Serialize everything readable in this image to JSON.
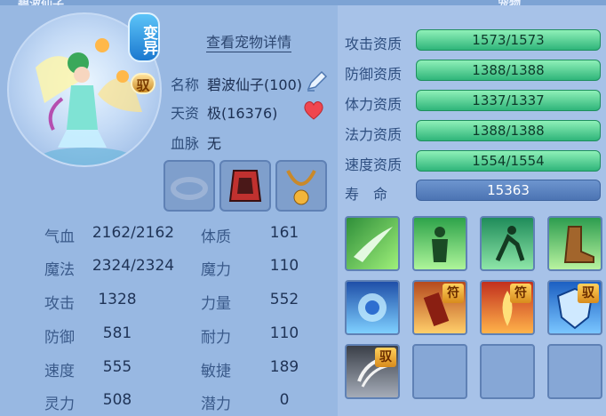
{
  "header": {
    "left_title": "碧波仙子",
    "right_title": "宠物"
  },
  "pet": {
    "variant_label": "变异",
    "rune_label": "驭",
    "view_detail_label": "查看宠物详情",
    "name_label": "名称",
    "name_value": "碧波仙子(100)",
    "talent_label": "天资",
    "talent_value": "极(16376)",
    "bloodline_label": "血脉",
    "bloodline_value": "无"
  },
  "stats": [
    {
      "label": "气血",
      "value": "2162/2162"
    },
    {
      "label": "魔法",
      "value": "2324/2324"
    },
    {
      "label": "攻击",
      "value": "1328"
    },
    {
      "label": "防御",
      "value": "581"
    },
    {
      "label": "速度",
      "value": "555"
    },
    {
      "label": "灵力",
      "value": "508"
    }
  ],
  "attributes": [
    {
      "label": "体质",
      "value": "161"
    },
    {
      "label": "魔力",
      "value": "110"
    },
    {
      "label": "力量",
      "value": "552"
    },
    {
      "label": "耐力",
      "value": "110"
    },
    {
      "label": "敏捷",
      "value": "189"
    },
    {
      "label": "潜力",
      "value": "0"
    }
  ],
  "aptitudes": [
    {
      "label": "攻击资质",
      "value": "1573/1573"
    },
    {
      "label": "防御资质",
      "value": "1388/1388"
    },
    {
      "label": "体力资质",
      "value": "1337/1337"
    },
    {
      "label": "法力资质",
      "value": "1388/1388"
    },
    {
      "label": "速度资质",
      "value": "1554/1554"
    }
  ],
  "lifespan": {
    "label": "寿　命",
    "value": "15363"
  },
  "skills": [
    {
      "icon": "wind-blade-skill-icon"
    },
    {
      "icon": "green-aura-skill-icon"
    },
    {
      "icon": "dash-skill-icon"
    },
    {
      "icon": "boot-skill-icon"
    },
    {
      "icon": "water-spirit-skill-icon"
    },
    {
      "icon": "talisman-skill-icon",
      "tag": "符"
    },
    {
      "icon": "fire-talisman-skill-icon",
      "tag": "符"
    },
    {
      "icon": "shield-skill-icon",
      "tag": "驭"
    },
    {
      "icon": "claw-skill-icon",
      "tag": "驭"
    }
  ],
  "colors": {
    "bar_green": "#2fb57a",
    "bar_blue": "#4c74b3",
    "panel": "#98b8e2",
    "skill_tag": "#d88b1c"
  }
}
